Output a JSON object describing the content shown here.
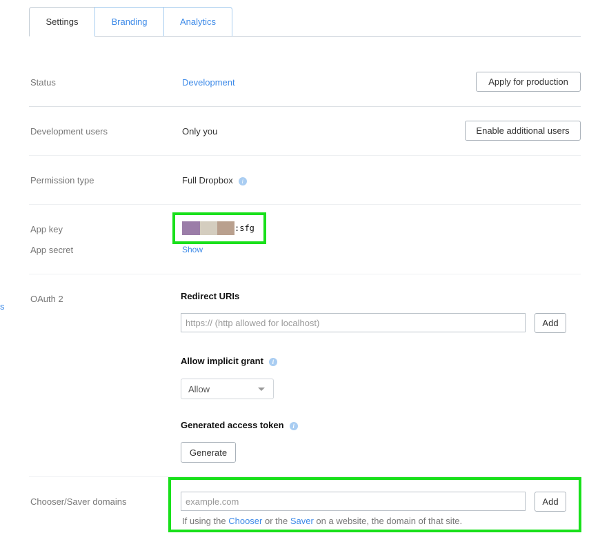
{
  "tabs": [
    {
      "label": "Settings"
    },
    {
      "label": "Branding"
    },
    {
      "label": "Analytics"
    }
  ],
  "edge_link": "s",
  "status": {
    "label": "Status",
    "value": "Development",
    "button": "Apply for production"
  },
  "dev_users": {
    "label": "Development users",
    "value": "Only you",
    "button": "Enable additional users"
  },
  "permission": {
    "label": "Permission type",
    "value": "Full Dropbox"
  },
  "app_key": {
    "label": "App key",
    "value_suffix": ":sfg",
    "redaction_colors": [
      "#9b7da8",
      "#d4cdbf",
      "#b9a08e"
    ]
  },
  "app_secret": {
    "label": "App secret",
    "link": "Show"
  },
  "oauth": {
    "label": "OAuth 2",
    "redirect_title": "Redirect URIs",
    "redirect_placeholder": "https:// (http allowed for localhost)",
    "add": "Add",
    "implicit_title": "Allow implicit grant",
    "implicit_value": "Allow",
    "token_title": "Generated access token",
    "generate": "Generate"
  },
  "chooser": {
    "label": "Chooser/Saver domains",
    "placeholder": "example.com",
    "add": "Add",
    "help_pre": "If using the ",
    "chooser_link": "Chooser",
    "help_mid": " or the ",
    "saver_link": "Saver",
    "help_post": " on a website, the domain of that site."
  },
  "colors": {
    "accent": "#3d8ae8",
    "highlight": "#19e01b"
  }
}
